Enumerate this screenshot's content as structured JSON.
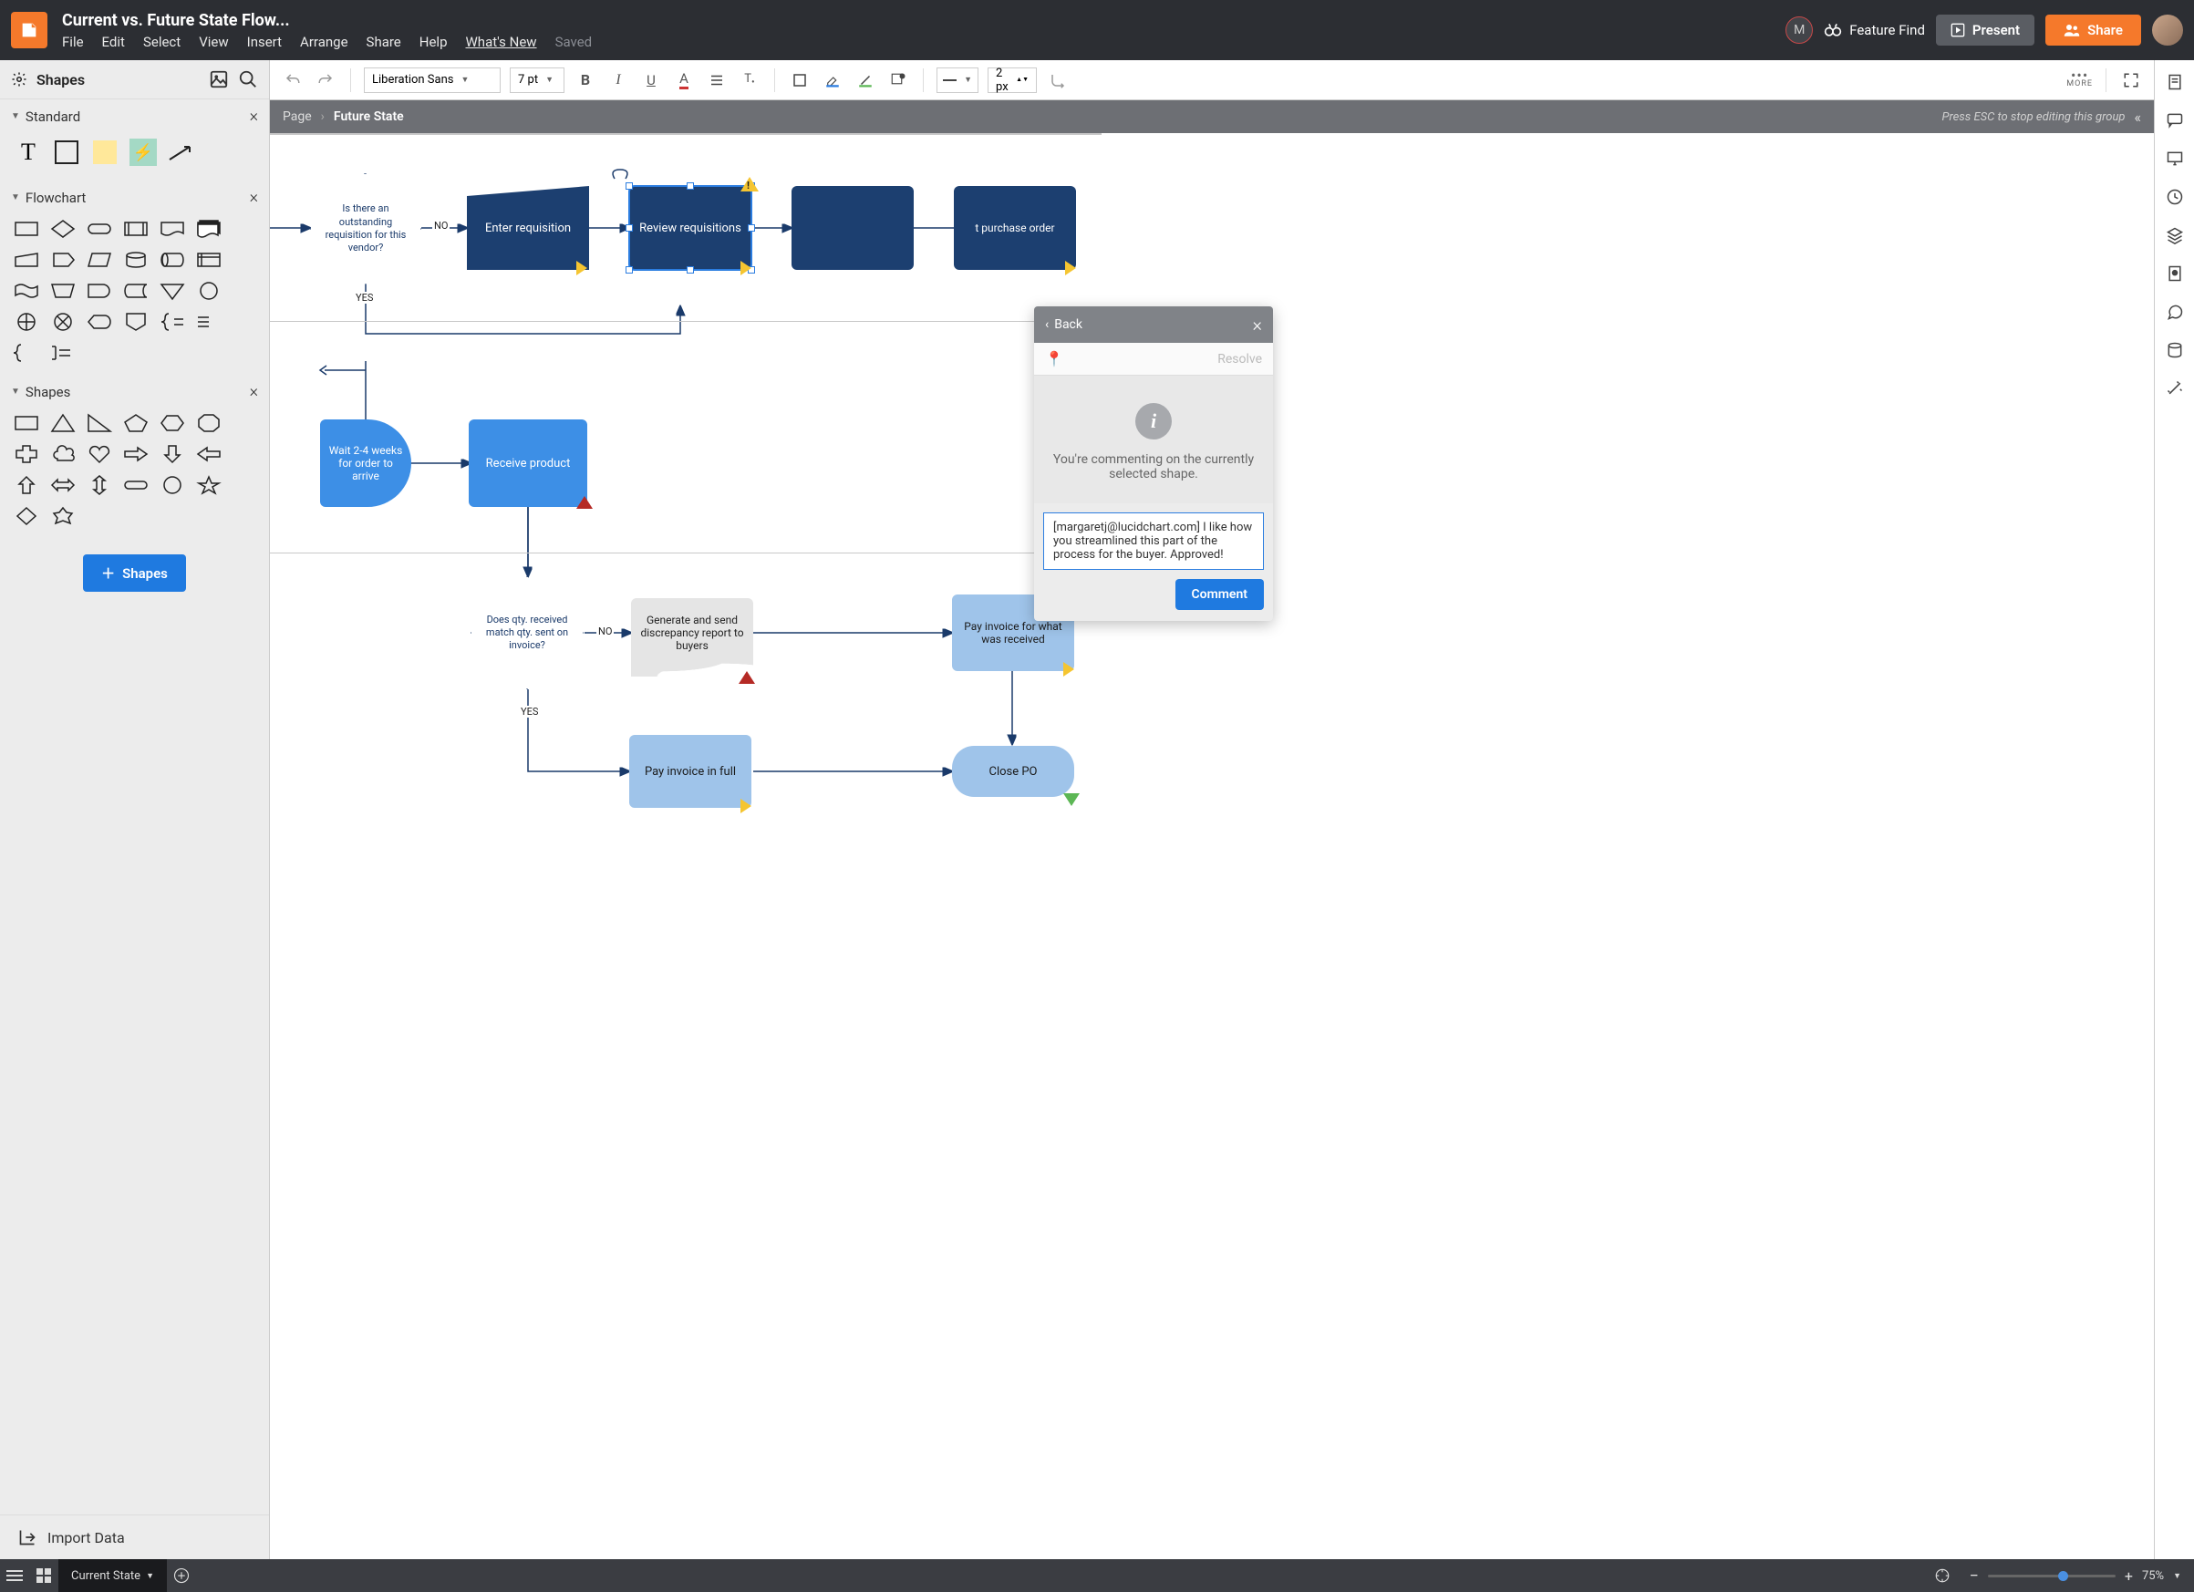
{
  "header": {
    "doc_title": "Current vs. Future State Flow...",
    "menu": {
      "file": "File",
      "edit": "Edit",
      "select": "Select",
      "view": "View",
      "insert": "Insert",
      "arrange": "Arrange",
      "share": "Share",
      "help": "Help",
      "whats_new": "What's New",
      "saved": "Saved"
    },
    "avatar_initial": "M",
    "feature_find": "Feature Find",
    "present": "Present",
    "share_btn": "Share"
  },
  "left": {
    "shapes_title": "Shapes",
    "sections": {
      "standard": "Standard",
      "flowchart": "Flowchart",
      "shapes": "Shapes"
    },
    "add_shapes": "Shapes",
    "import_data": "Import Data"
  },
  "toolbar": {
    "font": "Liberation Sans",
    "font_size": "7 pt",
    "line_width": "2 px",
    "more": "MORE"
  },
  "crumb": {
    "page": "Page",
    "current": "Future State",
    "hint": "Press ESC to stop editing this group"
  },
  "nodes": {
    "decision1": "Is there an outstanding requisition for this vendor?",
    "enter_req": "Enter requisition",
    "review_req": "Review requisitions",
    "submit_po": "t purchase order",
    "wait": "Wait 2-4 weeks for order to arrive",
    "receive": "Receive product",
    "qty_match": "Does qty. received match qty. sent on invoice?",
    "discrepancy": "Generate and send discrepancy report to buyers",
    "pay_received": "Pay invoice for what was received",
    "pay_full": "Pay invoice in full",
    "close_po": "Close PO"
  },
  "edge_labels": {
    "no1": "NO",
    "yes1": "YES",
    "no2": "NO",
    "yes2": "YES"
  },
  "comment": {
    "back": "Back",
    "resolve": "Resolve",
    "info_text": "You're commenting on the currently selected shape.",
    "input_text": "[margaretj@lucidchart.com] I like how you streamlined this part of the process for the buyer. Approved!",
    "comment_btn": "Comment"
  },
  "bottom": {
    "tab": "Current State",
    "zoom": "75%"
  },
  "colors": {
    "accent": "#f5792b",
    "primary_blue": "#1f7ae0",
    "node_dark": "#1c3f70",
    "node_light": "#9fc4ea",
    "node_mid": "#3d8fe6"
  }
}
